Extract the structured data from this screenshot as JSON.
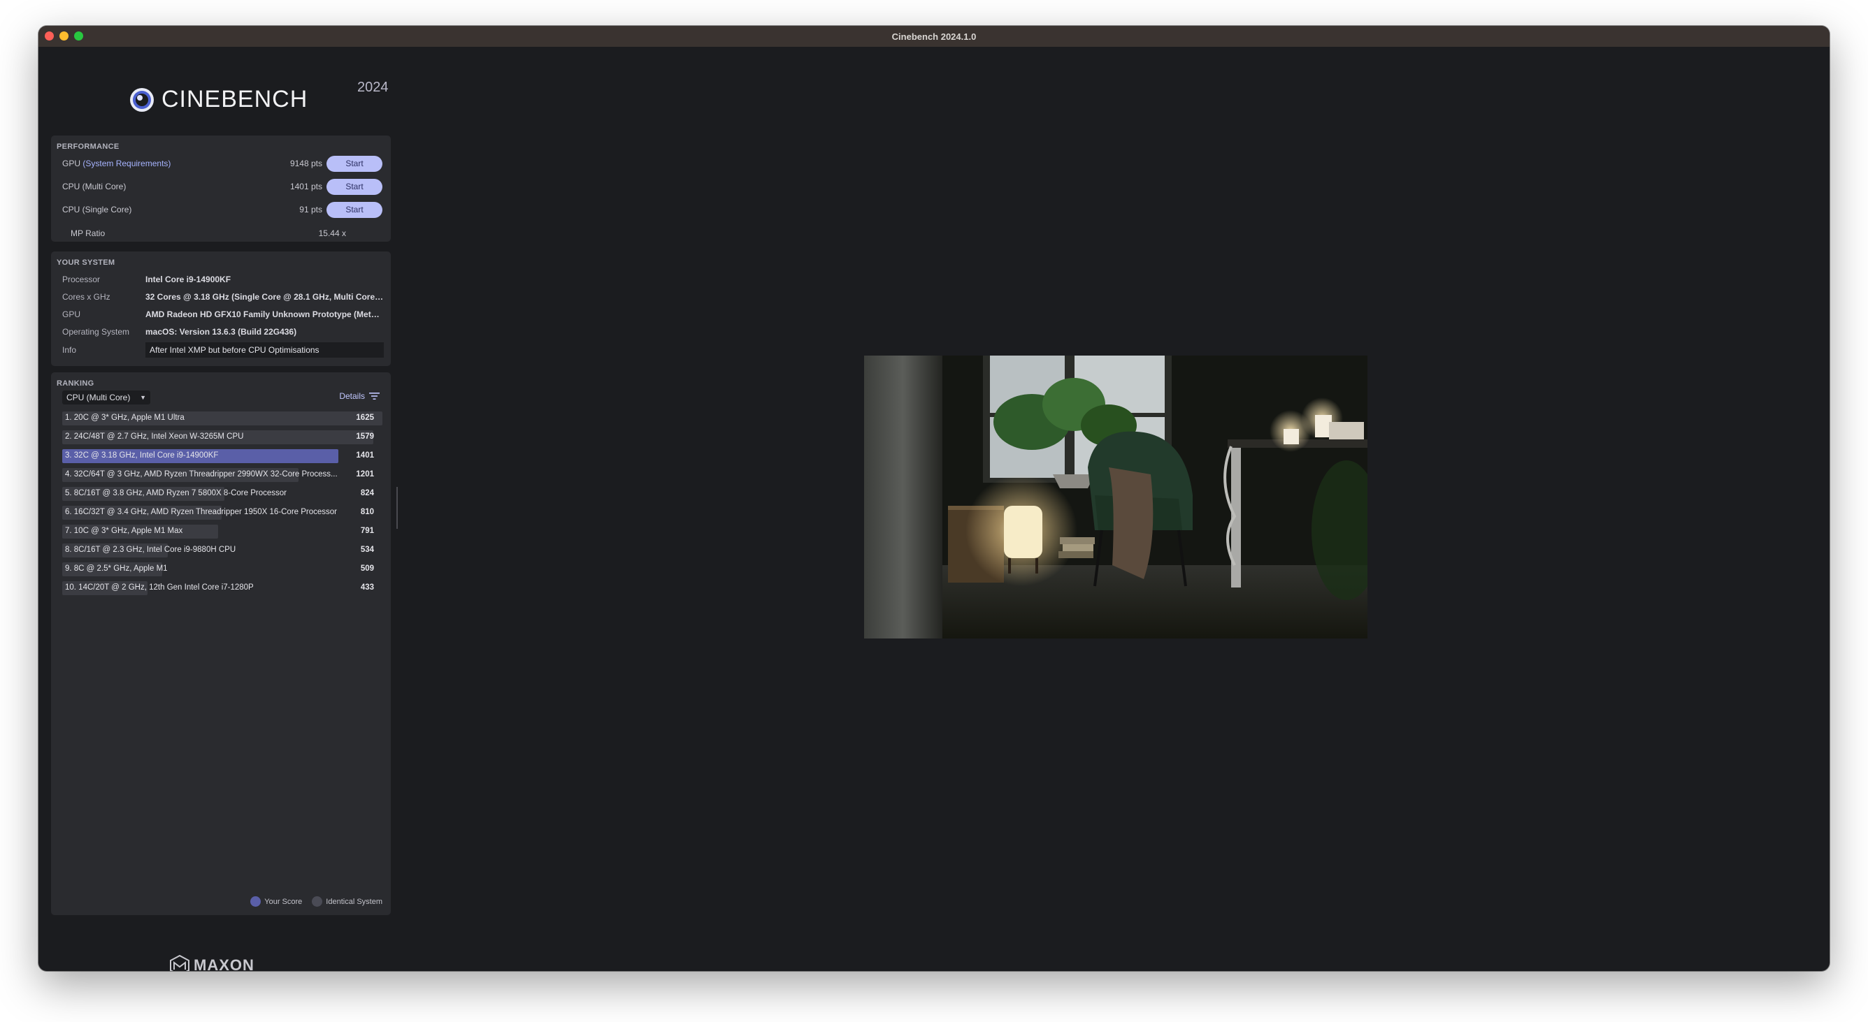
{
  "window": {
    "title": "Cinebench 2024.1.0"
  },
  "brand": {
    "name": "CINEBENCH",
    "year": "2024",
    "company": "MAXON"
  },
  "performance": {
    "title": "PERFORMANCE",
    "rows": [
      {
        "name_prefix": "GPU",
        "name_highlight": "(System Requirements)",
        "name_rest": "",
        "score": "9148 pts",
        "button": "Start"
      },
      {
        "name_prefix": "CPU (Multi Core)",
        "name_highlight": "",
        "name_rest": "",
        "score": "1401 pts",
        "button": "Start"
      },
      {
        "name_prefix": "CPU (Single Core)",
        "name_highlight": "",
        "name_rest": "",
        "score": "91 pts",
        "button": "Start"
      }
    ],
    "mp_ratio": {
      "label": "MP Ratio",
      "value": "15.44 x"
    }
  },
  "system": {
    "title": "YOUR SYSTEM",
    "rows": [
      {
        "label": "Processor",
        "value": "Intel Core i9-14900KF"
      },
      {
        "label": "Cores x GHz",
        "value": "32 Cores @ 3.18 GHz (Single Core @ 28.1 GHz, Multi Core @..."
      },
      {
        "label": "GPU",
        "value": "AMD Radeon HD GFX10 Family Unknown Prototype (Metal, ..."
      },
      {
        "label": "Operating System",
        "value": "macOS: Version 13.6.3 (Build 22G436)"
      }
    ],
    "info": {
      "label": "Info",
      "value": "After Intel XMP but before CPU Optimisations"
    }
  },
  "ranking": {
    "title": "RANKING",
    "selected": "CPU (Multi Core)",
    "details_label": "Details",
    "items": [
      {
        "label": "1. 20C @ 3* GHz, Apple M1 Ultra",
        "score": "1625",
        "value": 1625,
        "you": false
      },
      {
        "label": "2. 24C/48T @ 2.7 GHz, Intel Xeon W-3265M CPU",
        "score": "1579",
        "value": 1579,
        "you": false
      },
      {
        "label": "3. 32C @ 3.18 GHz, Intel Core i9-14900KF",
        "score": "1401",
        "value": 1401,
        "you": true
      },
      {
        "label": "4. 32C/64T @ 3 GHz, AMD Ryzen Threadripper 2990WX 32-Core Process...",
        "score": "1201",
        "value": 1201,
        "you": false
      },
      {
        "label": "5. 8C/16T @ 3.8 GHz, AMD Ryzen 7 5800X 8-Core Processor",
        "score": "824",
        "value": 824,
        "you": false
      },
      {
        "label": "6. 16C/32T @ 3.4 GHz, AMD Ryzen Threadripper 1950X 16-Core Processor",
        "score": "810",
        "value": 810,
        "you": false
      },
      {
        "label": "7. 10C @ 3* GHz, Apple M1 Max",
        "score": "791",
        "value": 791,
        "you": false
      },
      {
        "label": "8. 8C/16T @ 2.3 GHz, Intel Core i9-9880H CPU",
        "score": "534",
        "value": 534,
        "you": false
      },
      {
        "label": "9. 8C @ 2.5* GHz, Apple M1",
        "score": "509",
        "value": 509,
        "you": false
      },
      {
        "label": "10. 14C/20T @ 2 GHz, 12th Gen Intel Core i7-1280P",
        "score": "433",
        "value": 433,
        "you": false
      }
    ],
    "legend": {
      "your_score": "Your Score",
      "identical_system": "Identical System"
    }
  },
  "colors": {
    "accent": "#b9bff8",
    "your_score": "#5a5fa8",
    "background": "#1b1c1f",
    "panel": "#2a2b2f"
  }
}
